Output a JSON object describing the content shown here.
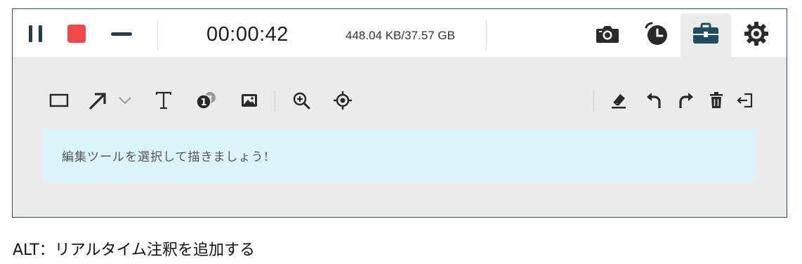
{
  "topbar": {
    "pause_icon": "pause-icon",
    "stop_icon": "stop-icon",
    "minimize_icon": "minimize-icon",
    "elapsed_time": "00:00:42",
    "file_size": "448.04 KB/37.57 GB",
    "screenshot_icon": "camera-icon",
    "schedule_icon": "clock-icon",
    "toolbox_icon": "toolbox-icon",
    "settings_icon": "gear-icon",
    "active_tab": "toolbox",
    "colors": {
      "pause": "#1d3f4d",
      "stop": "#f04848",
      "accent": "#1e4c63",
      "icon": "#2a2a2a"
    }
  },
  "editor": {
    "tools": [
      {
        "name": "rectangle",
        "icon": "rectangle-icon"
      },
      {
        "name": "arrow",
        "icon": "arrow-icon"
      },
      {
        "name": "arrow-options",
        "icon": "chevron-down-icon"
      },
      {
        "name": "text",
        "icon": "text-icon"
      },
      {
        "name": "numbered-step",
        "icon": "step-number-icon"
      },
      {
        "name": "image",
        "icon": "image-icon"
      },
      {
        "name": "zoom",
        "icon": "zoom-in-icon"
      },
      {
        "name": "spotlight",
        "icon": "crosshair-icon"
      },
      {
        "name": "eraser",
        "icon": "eraser-icon"
      },
      {
        "name": "undo",
        "icon": "undo-icon"
      },
      {
        "name": "redo",
        "icon": "redo-icon"
      },
      {
        "name": "delete",
        "icon": "trash-icon"
      },
      {
        "name": "exit",
        "icon": "exit-icon"
      }
    ],
    "hint": "編集ツールを選択して描きましょう!",
    "hint_bg": "#dbf4fa"
  },
  "caption": "ALT：リアルタイム注釈を追加する"
}
